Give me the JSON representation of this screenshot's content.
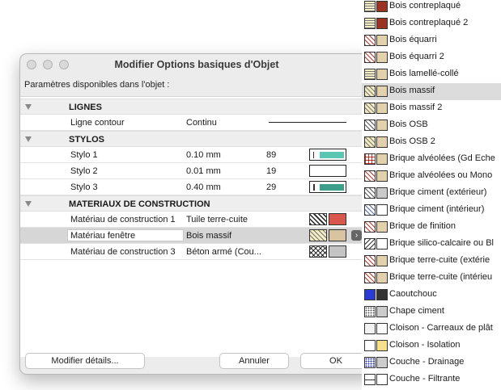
{
  "dialog": {
    "title": "Modifier Options basiques d'Objet",
    "subtitle": "Paramètres disponibles dans l'objet :",
    "sections": {
      "lignes": "LIGNES",
      "stylos": "STYLOS",
      "materiaux": "MATERIAUX DE CONSTRUCTION"
    },
    "ligne_contour": {
      "name": "Ligne contour",
      "value": "Continu"
    },
    "pens": [
      {
        "name": "Stylo 1",
        "width": "0.10 mm",
        "index": "89",
        "color": "#5bc6b4"
      },
      {
        "name": "Stylo 2",
        "width": "0.01 mm",
        "index": "19",
        "color": "#ffffff"
      },
      {
        "name": "Stylo 3",
        "width": "0.40 mm",
        "index": "29",
        "color": "#3d9e8a"
      }
    ],
    "materials": [
      {
        "name": "Matériau de construction 1",
        "value": "Tuile terre-cuite",
        "fill": "#d8574a"
      },
      {
        "name": "Matériau fenêtre",
        "value": "Bois massif",
        "fill": "#d9c4a1"
      },
      {
        "name": "Matériau de construction 3",
        "value": "Béton armé (Cou...",
        "fill": "#c4c4c4"
      }
    ],
    "buttons": {
      "details": "Modifier détails...",
      "cancel": "Annuler",
      "ok": "OK"
    }
  },
  "material_list": [
    {
      "label": "Bois contreplaqué",
      "fill": "#9a3324",
      "pattern": "p-hlines"
    },
    {
      "label": "Bois contreplaqué 2",
      "fill": "#9a3324",
      "pattern": "p-hlines"
    },
    {
      "label": "Bois équarri",
      "fill": "#e3d1ad",
      "pattern": "p-diagr"
    },
    {
      "label": "Bois équarri 2",
      "fill": "#e3d1ad",
      "pattern": "p-diagr"
    },
    {
      "label": "Bois lamellé-collé",
      "fill": "#e3d1ad",
      "pattern": "p-hlines"
    },
    {
      "label": "Bois massif",
      "fill": "#e3d1ad",
      "pattern": "p-diag"
    },
    {
      "label": "Bois massif 2",
      "fill": "#e3d1ad",
      "pattern": "p-diag"
    },
    {
      "label": "Bois OSB",
      "fill": "#e3d1ad",
      "pattern": "p-diagd"
    },
    {
      "label": "Bois OSB 2",
      "fill": "#e3d1ad",
      "pattern": "p-diag"
    },
    {
      "label": "Brique alvéolées (Gd Eche",
      "fill": "#e3d1ad",
      "pattern": "p-brick"
    },
    {
      "label": "Brique alvéolées ou Mono",
      "fill": "#e3d1ad",
      "pattern": "p-diagr"
    },
    {
      "label": "Brique ciment (extérieur)",
      "fill": "#c9c9c9",
      "pattern": "p-diagd"
    },
    {
      "label": "Brique ciment (intérieur)",
      "fill": "#ffffff",
      "pattern": "p-diagb"
    },
    {
      "label": "Brique de finition",
      "fill": "#e3d1ad",
      "pattern": "p-diagr"
    },
    {
      "label": "Brique silico-calcaire ou Bl",
      "fill": "#ffffff",
      "pattern": "p-hatch2"
    },
    {
      "label": "Brique terre-cuite (extérie",
      "fill": "#e3d1ad",
      "pattern": "p-diagr"
    },
    {
      "label": "Brique terre-cuite (intérieu",
      "fill": "#e3d1ad",
      "pattern": "p-diagr"
    },
    {
      "label": "Caoutchouc",
      "fill": "#333333",
      "pattern": "solid-blue"
    },
    {
      "label": "Chape ciment",
      "fill": "#cccccc",
      "pattern": "p-dots"
    },
    {
      "label": "Cloison - Carreaux de plât",
      "fill": "#ffffff",
      "pattern": "plain"
    },
    {
      "label": "Cloison - Isolation",
      "fill": "#f6e08a",
      "pattern": "plain-yellow"
    },
    {
      "label": "Couche - Drainage",
      "fill": "#cccccc",
      "pattern": "p-dotsb"
    },
    {
      "label": "Couche - Filtrante",
      "fill": "#ffffff",
      "pattern": "p-dash"
    }
  ]
}
